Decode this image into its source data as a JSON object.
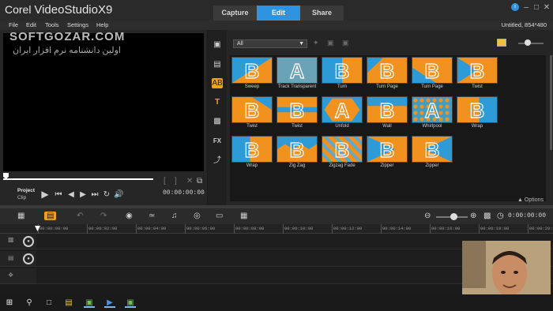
{
  "app": {
    "brand": "Corel",
    "product": "VideoStudio",
    "version": "X9",
    "project_info": "Untitled, 854*480"
  },
  "mode_tabs": [
    {
      "label": "Capture",
      "active": false
    },
    {
      "label": "Edit",
      "active": true
    },
    {
      "label": "Share",
      "active": false
    }
  ],
  "menu": [
    "File",
    "Edit",
    "Tools",
    "Settings",
    "Help"
  ],
  "watermark": {
    "line1": "SOFTGOZAR.COM",
    "line2": "اولین دانشنامه نرم افزار ایران"
  },
  "preview": {
    "project_label": "Project",
    "clip_label": "Clip",
    "timecode": "00:00:00:00"
  },
  "library": {
    "filter_value": "All",
    "side_icons": [
      "media-icon",
      "instant-project-icon",
      "transition-icon",
      "title-icon",
      "graphic-icon",
      "fx-filter-icon",
      "path-icon"
    ],
    "selected_icon": "transition-icon",
    "options_label": "Options",
    "transitions": [
      {
        "label": "Sweep",
        "letter": "B",
        "pattern": "d1"
      },
      {
        "label": "Track Transparent",
        "letter": "A",
        "pattern": "fade"
      },
      {
        "label": "Turn",
        "letter": "B",
        "pattern": "d2"
      },
      {
        "label": "Turn Page",
        "letter": "B",
        "pattern": "corner"
      },
      {
        "label": "Turn Page",
        "letter": "B",
        "pattern": "corner2"
      },
      {
        "label": "Twist",
        "letter": "B",
        "pattern": "twist"
      },
      {
        "label": "Twist",
        "letter": "B",
        "pattern": "twist2"
      },
      {
        "label": "Twist",
        "letter": "B",
        "pattern": "cross"
      },
      {
        "label": "Unfold",
        "letter": "A",
        "pattern": "oct"
      },
      {
        "label": "Wall",
        "letter": "B",
        "pattern": "wall"
      },
      {
        "label": "Whirlpool",
        "letter": "A",
        "pattern": "whirl"
      },
      {
        "label": "Wrap",
        "letter": "B",
        "pattern": "wrap"
      },
      {
        "label": "Wrap",
        "letter": "B",
        "pattern": "wrap2"
      },
      {
        "label": "Zig Zag",
        "letter": "B",
        "pattern": "zig"
      },
      {
        "label": "Zigzag Fade",
        "letter": "B",
        "pattern": "zigfade"
      },
      {
        "label": "Zipper",
        "letter": "B",
        "pattern": "zip"
      },
      {
        "label": "Zipper",
        "letter": "B",
        "pattern": "zip2"
      }
    ]
  },
  "timeline": {
    "timecode": "0:00:00:00",
    "ruler": [
      "00:00:00:00",
      "00:00:02:00",
      "00:00:04:00",
      "00:00:06:00",
      "00:00:08:00",
      "00:00:10:00",
      "00:00:12:00",
      "00:00:14:00",
      "00:00:16:00",
      "00:00:18:00",
      "00:00:20:0"
    ]
  },
  "colors": {
    "accent": "#2e93e0",
    "thumb_orange": "#f2921e",
    "thumb_blue": "#2e9ad6",
    "selected": "#f0a21c"
  }
}
